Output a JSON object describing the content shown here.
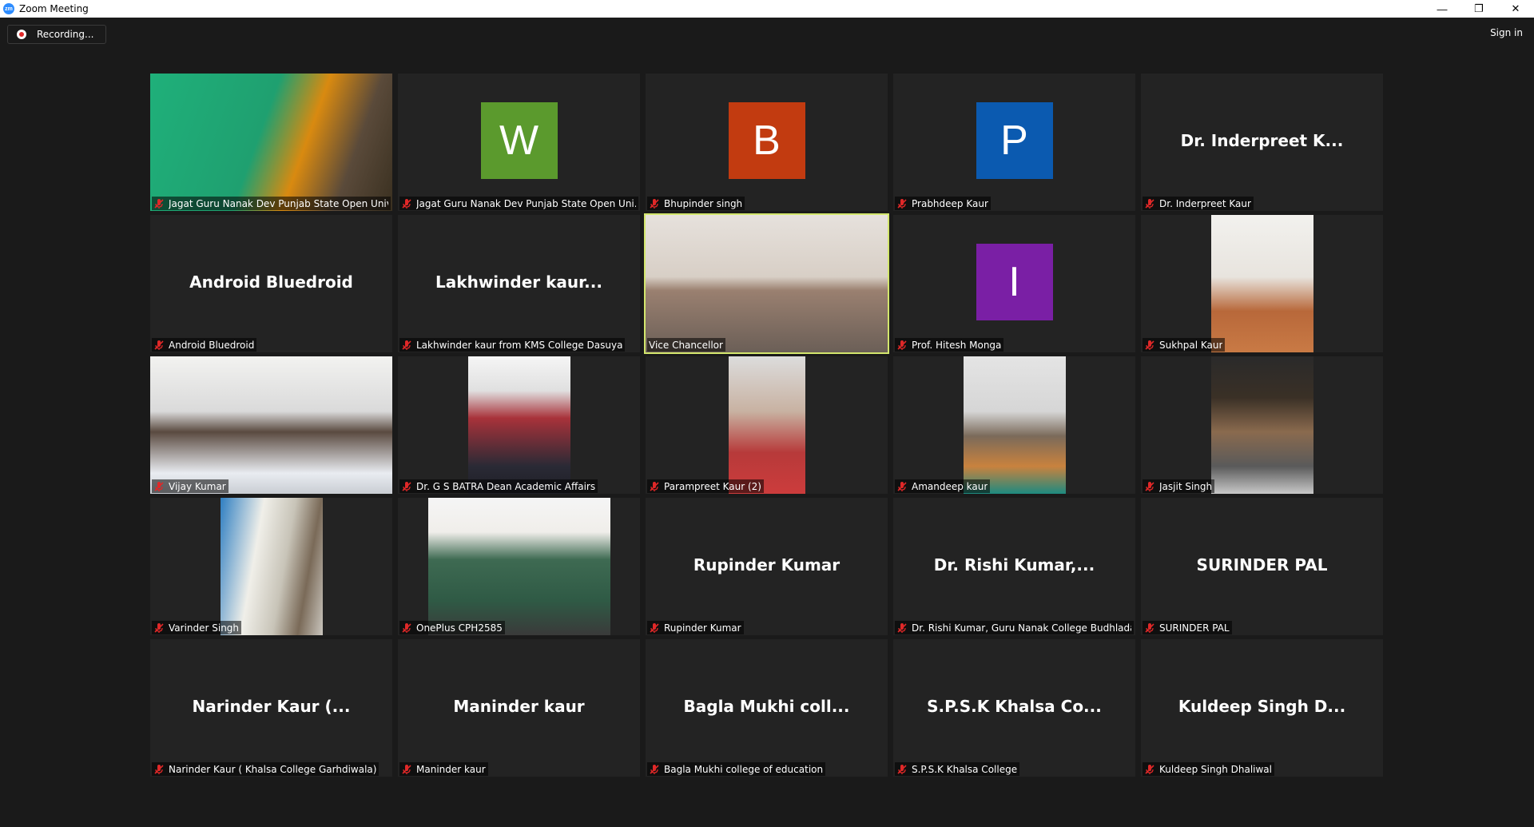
{
  "window": {
    "title": "Zoom Meeting",
    "controls": [
      "—",
      "❐",
      "✕"
    ],
    "logo_text": "zm"
  },
  "recording": {
    "label": "Recording..."
  },
  "signin": {
    "label": "Sign in"
  },
  "colors": {
    "active_border": "#d3e66d",
    "mic_muted": "#e02828",
    "tile_bg": "#232323"
  },
  "tiles": [
    {
      "kind": "video",
      "name": "Jagat Guru Nanak Dev Punjab State Open Univer...",
      "muted": true
    },
    {
      "kind": "avatar",
      "initial": "W",
      "color": "#5b9a2d",
      "name": "Jagat Guru Nanak Dev Punjab State Open Uni...",
      "muted": true
    },
    {
      "kind": "avatar",
      "initial": "B",
      "color": "#c23b10",
      "name": "Bhupinder singh",
      "muted": true
    },
    {
      "kind": "avatar",
      "initial": "P",
      "color": "#0b5ab0",
      "name": "Prabhdeep Kaur",
      "muted": true
    },
    {
      "kind": "text",
      "display": "Dr. Inderpreet K...",
      "name": "Dr. Inderpreet Kaur",
      "muted": true
    },
    {
      "kind": "text",
      "display": "Android Bluedroid",
      "name": "Android Bluedroid",
      "muted": true
    },
    {
      "kind": "text",
      "display": "Lakhwinder  kaur...",
      "name": "Lakhwinder kaur from KMS College Dasuya",
      "muted": true
    },
    {
      "kind": "video",
      "name": "Vice Chancellor",
      "muted": false,
      "active": true
    },
    {
      "kind": "avatar",
      "initial": "I",
      "color": "#7a1fa5",
      "name": "Prof.  Hitesh Monga",
      "muted": true
    },
    {
      "kind": "video",
      "name": "Sukhpal Kaur",
      "muted": true
    },
    {
      "kind": "video",
      "name": "Vijay Kumar",
      "muted": true
    },
    {
      "kind": "video",
      "name": "Dr. G S BATRA Dean Academic Affairs",
      "muted": true
    },
    {
      "kind": "video",
      "name": "Parampreet Kaur (2)",
      "muted": true
    },
    {
      "kind": "video",
      "name": "Amandeep kaur",
      "muted": true
    },
    {
      "kind": "video",
      "name": "Jasjit Singh",
      "muted": true
    },
    {
      "kind": "video",
      "name": "Varinder Singh",
      "muted": true
    },
    {
      "kind": "video",
      "name": "OnePlus CPH2585",
      "muted": true
    },
    {
      "kind": "text",
      "display": "Rupinder Kumar",
      "name": "Rupinder Kumar",
      "muted": true
    },
    {
      "kind": "text",
      "display": "Dr.  Rishi  Kumar,...",
      "name": "Dr. Rishi Kumar, Guru Nanak College Budhlada",
      "muted": true
    },
    {
      "kind": "text",
      "display": "SURINDER PAL",
      "name": "SURINDER PAL",
      "muted": true
    },
    {
      "kind": "text",
      "display": "Narinder Kaur (...",
      "name": "Narinder Kaur ( Khalsa College Garhdiwala)",
      "muted": true
    },
    {
      "kind": "text",
      "display": "Maninder kaur",
      "name": "Maninder kaur",
      "muted": true
    },
    {
      "kind": "text",
      "display": "Bagla  Mukhi  coll...",
      "name": "Bagla Mukhi college of education",
      "muted": true
    },
    {
      "kind": "text",
      "display": "S.P.S.K  Khalsa  Co...",
      "name": "S.P.S.K Khalsa College",
      "muted": true
    },
    {
      "kind": "text",
      "display": "Kuldeep Singh D...",
      "name": "Kuldeep Singh Dhaliwal",
      "muted": true
    }
  ]
}
